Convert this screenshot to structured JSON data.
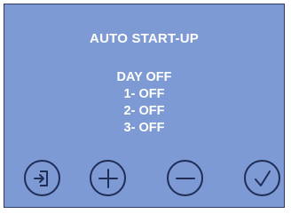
{
  "screen": {
    "title": "AUTO START-UP",
    "status_lines": [
      "DAY OFF",
      "1- OFF",
      "2- OFF",
      "3- OFF"
    ]
  },
  "buttons": [
    {
      "name": "exit-button",
      "icon": "exit-door-icon"
    },
    {
      "name": "increase-button",
      "icon": "plus-icon"
    },
    {
      "name": "decrease-button",
      "icon": "minus-icon"
    },
    {
      "name": "confirm-button",
      "icon": "checkmark-icon"
    }
  ],
  "colors": {
    "screen_background": "#7d9ad4",
    "text": "#ffffff",
    "icon_stroke": "#1f2d57"
  }
}
